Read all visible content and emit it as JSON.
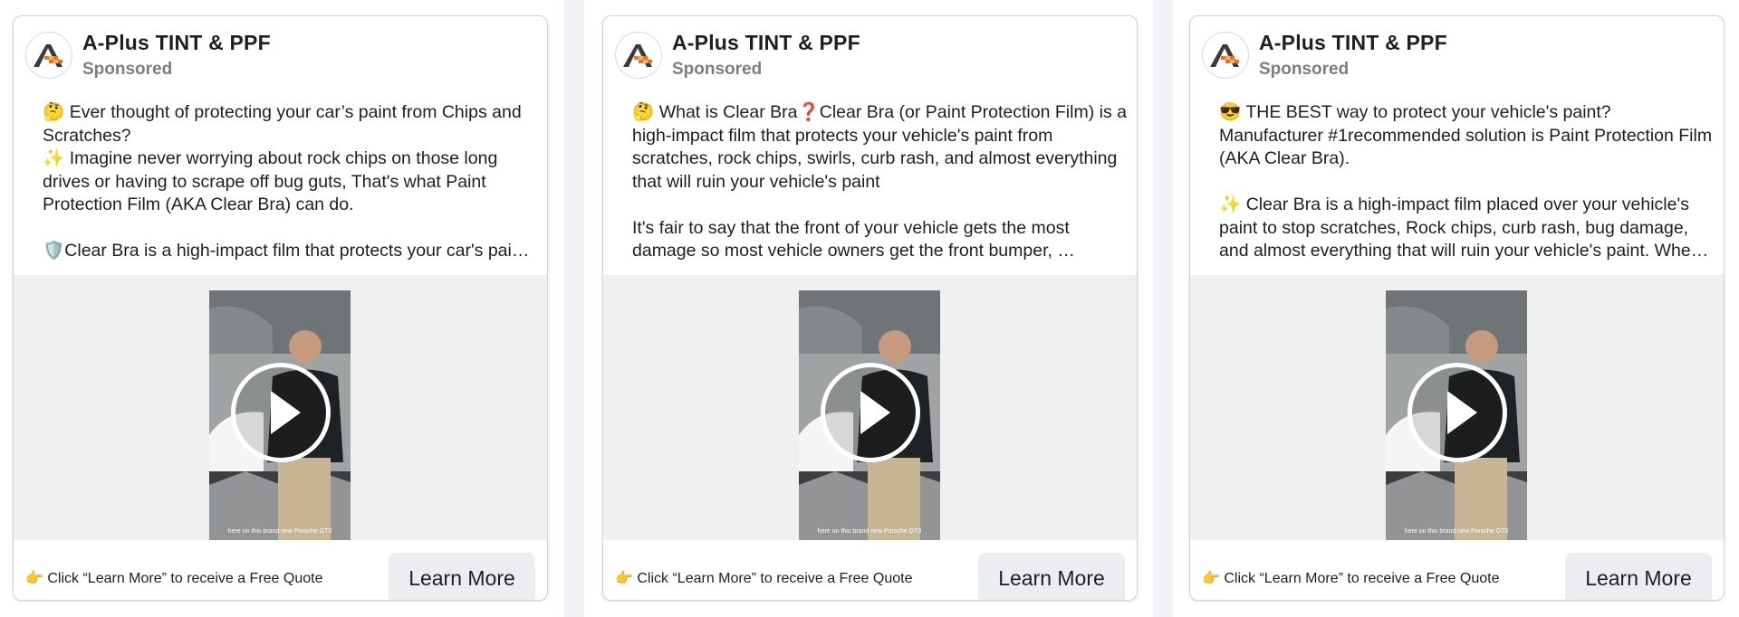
{
  "ads": [
    {
      "page_name": "A-Plus TINT & PPF",
      "sponsored": "Sponsored",
      "body": [
        "🤔 Ever thought of protecting your car’s paint from Chips and Scratches?",
        "✨ Imagine never worrying about rock chips on those long drives or having to scrape off bug guts, That's what Paint Protection Film (AKA Clear Bra) can do.",
        "",
        "🛡️Clear Bra is a high-impact film that protects your car's pain…"
      ],
      "video_caption": "here on this brand new Porsche GT3",
      "cta_text": "👉 Click “Learn More” to receive a Free Quote",
      "button_label": "Learn More"
    },
    {
      "page_name": "A-Plus TINT & PPF",
      "sponsored": "Sponsored",
      "body": [
        "🤔 What is Clear Bra❓Clear Bra (or Paint Protection Film) is a high-impact film that protects your vehicle's paint from scratches, rock chips, swirls, curb rash, and almost everything that will ruin your vehicle's paint",
        "",
        "It's fair to say that the front of your vehicle gets the most damage so most vehicle owners get the front bumper, …"
      ],
      "video_caption": "here on this brand new Porsche GT3",
      "cta_text": "👉 Click “Learn More” to receive a Free Quote",
      "button_label": "Learn More"
    },
    {
      "page_name": "A-Plus TINT & PPF",
      "sponsored": "Sponsored",
      "body": [
        "😎 THE BEST way to protect your vehicle's paint? Manufacturer #1recommended solution is Paint Protection Film (AKA Clear Bra).",
        "",
        "✨ Clear Bra is a high-impact film placed over your vehicle's paint to stop scratches, Rock chips, curb rash, bug damage, and almost everything that will ruin your vehicle's paint. Whe…"
      ],
      "video_caption": "here on this brand new Porsche GT3",
      "cta_text": "👉 Click “Learn More” to receive a Free Quote",
      "button_label": "Learn More"
    }
  ],
  "icons": {
    "avatar": "a-plus-logo-icon",
    "play": "play-icon"
  },
  "colors": {
    "logo_orange": "#e8731c",
    "logo_dark": "#3a3a3a",
    "button_bg": "#ebedf0",
    "secondary_text": "#7a7d82"
  }
}
